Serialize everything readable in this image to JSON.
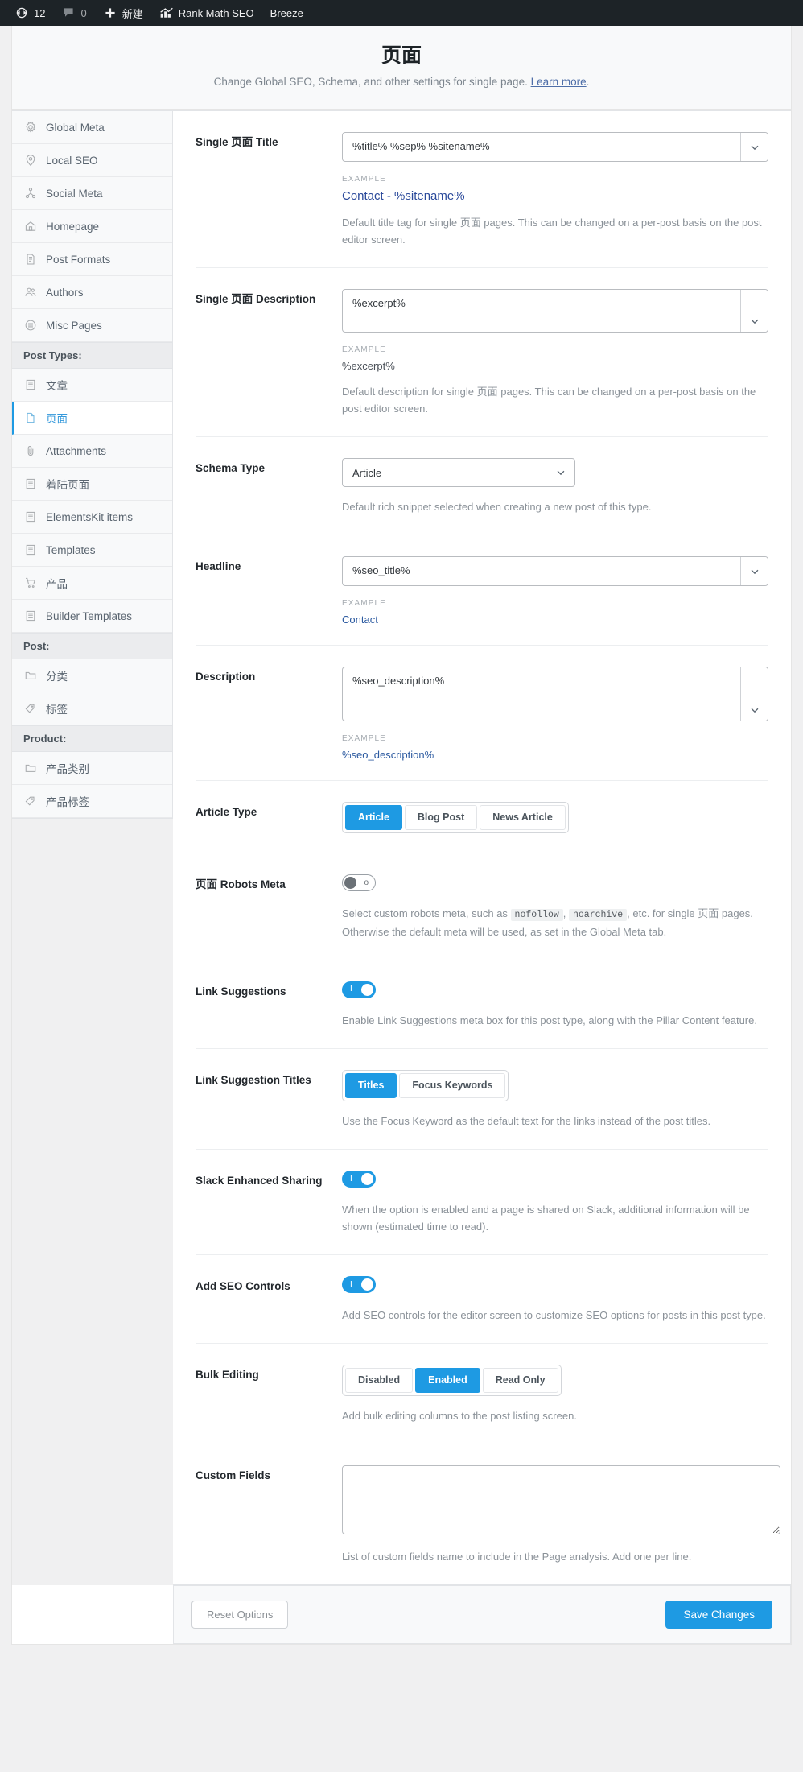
{
  "adminbar": {
    "items": [
      {
        "icon": "wordpress-updates-icon",
        "name": "updates",
        "count": "12"
      },
      {
        "icon": "comment-bubble-icon",
        "name": "comments",
        "count": "0"
      },
      {
        "icon": "plus-icon",
        "name": "new-content",
        "label": "新建"
      },
      {
        "icon": "rank-math-icon",
        "name": "rank-math-seo",
        "label": "Rank Math SEO"
      },
      {
        "icon": "",
        "name": "breeze",
        "label": "Breeze"
      }
    ]
  },
  "header": {
    "title": "页面",
    "subtitle": "Change Global SEO, Schema, and other settings for single page.",
    "learn_more": "Learn more",
    "learn_more_suffix": "."
  },
  "sidebar": {
    "items": [
      {
        "type": "item",
        "label": "Global Meta",
        "icon": "gear-icon",
        "active": false
      },
      {
        "type": "item",
        "label": "Local SEO",
        "icon": "map-pin-icon",
        "active": false
      },
      {
        "type": "item",
        "label": "Social Meta",
        "icon": "share-nodes-icon",
        "active": false
      },
      {
        "type": "item",
        "label": "Homepage",
        "icon": "home-icon",
        "active": false
      },
      {
        "type": "item",
        "label": "Post Formats",
        "icon": "document-icon",
        "active": false
      },
      {
        "type": "item",
        "label": "Authors",
        "icon": "users-icon",
        "active": false
      },
      {
        "type": "item",
        "label": "Misc Pages",
        "icon": "list-circle-icon",
        "active": false
      },
      {
        "type": "group",
        "label": "Post Types:"
      },
      {
        "type": "item",
        "label": "文章",
        "icon": "post-icon",
        "active": false
      },
      {
        "type": "item",
        "label": "页面",
        "icon": "page-icon",
        "active": true
      },
      {
        "type": "item",
        "label": "Attachments",
        "icon": "paperclip-icon",
        "active": false
      },
      {
        "type": "item",
        "label": "着陆页面",
        "icon": "post-icon",
        "active": false
      },
      {
        "type": "item",
        "label": "ElementsKit items",
        "icon": "post-icon",
        "active": false
      },
      {
        "type": "item",
        "label": "Templates",
        "icon": "post-icon",
        "active": false
      },
      {
        "type": "item",
        "label": "产品",
        "icon": "cart-icon",
        "active": false
      },
      {
        "type": "item",
        "label": "Builder Templates",
        "icon": "post-icon",
        "active": false
      },
      {
        "type": "group",
        "label": "Post:"
      },
      {
        "type": "item",
        "label": "分类",
        "icon": "folder-icon",
        "active": false
      },
      {
        "type": "item",
        "label": "标签",
        "icon": "tag-icon",
        "active": false
      },
      {
        "type": "group",
        "label": "Product:"
      },
      {
        "type": "item",
        "label": "产品类别",
        "icon": "folder-icon",
        "active": false
      },
      {
        "type": "item",
        "label": "产品标签",
        "icon": "tag-icon",
        "active": false
      }
    ]
  },
  "fields": {
    "single_title": {
      "label": "Single 页面 Title",
      "value": "%title% %sep% %sitename%",
      "example_label": "EXAMPLE",
      "example_value": "Contact - %sitename%",
      "help": "Default title tag for single 页面 pages. This can be changed on a per-post basis on the post editor screen."
    },
    "single_description": {
      "label": "Single 页面 Description",
      "value": "%excerpt%",
      "example_label": "EXAMPLE",
      "example_value": "%excerpt%",
      "help": "Default description for single 页面 pages. This can be changed on a per-post basis on the post editor screen."
    },
    "schema_type": {
      "label": "Schema Type",
      "value": "Article",
      "options": [
        "Article"
      ],
      "help": "Default rich snippet selected when creating a new post of this type."
    },
    "headline": {
      "label": "Headline",
      "value": "%seo_title%",
      "example_label": "EXAMPLE",
      "example_value": "Contact"
    },
    "description": {
      "label": "Description",
      "value": "%seo_description%",
      "example_label": "EXAMPLE",
      "example_value": "%seo_description%"
    },
    "article_type": {
      "label": "Article Type",
      "options": [
        "Article",
        "Blog Post",
        "News Article"
      ],
      "selected": "Article"
    },
    "robots_meta": {
      "label": "页面 Robots Meta",
      "enabled": false,
      "help_pre": "Select custom robots meta, such as ",
      "code1": "nofollow",
      "help_mid1": ", ",
      "code2": "noarchive",
      "help_post": ", etc. for single 页面 pages. Otherwise the default meta will be used, as set in the Global Meta tab."
    },
    "link_suggestions": {
      "label": "Link Suggestions",
      "enabled": true,
      "help": "Enable Link Suggestions meta box for this post type, along with the Pillar Content feature."
    },
    "link_suggestion_titles": {
      "label": "Link Suggestion Titles",
      "options": [
        "Titles",
        "Focus Keywords"
      ],
      "selected": "Titles",
      "help": "Use the Focus Keyword as the default text for the links instead of the post titles."
    },
    "slack_enhanced_sharing": {
      "label": "Slack Enhanced Sharing",
      "enabled": true,
      "help": "When the option is enabled and a page is shared on Slack, additional information will be shown (estimated time to read)."
    },
    "add_seo_controls": {
      "label": "Add SEO Controls",
      "enabled": true,
      "help": "Add SEO controls for the editor screen to customize SEO options for posts in this post type."
    },
    "bulk_editing": {
      "label": "Bulk Editing",
      "options": [
        "Disabled",
        "Enabled",
        "Read Only"
      ],
      "selected": "Enabled",
      "help": "Add bulk editing columns to the post listing screen."
    },
    "custom_fields": {
      "label": "Custom Fields",
      "value": "",
      "help": "List of custom fields name to include in the Page analysis. Add one per line."
    }
  },
  "footer": {
    "reset_label": "Reset Options",
    "save_label": "Save Changes"
  },
  "colors": {
    "accent": "#1e9ae3",
    "adminbar_bg": "#1d2327",
    "link": "#2c5aa0"
  }
}
